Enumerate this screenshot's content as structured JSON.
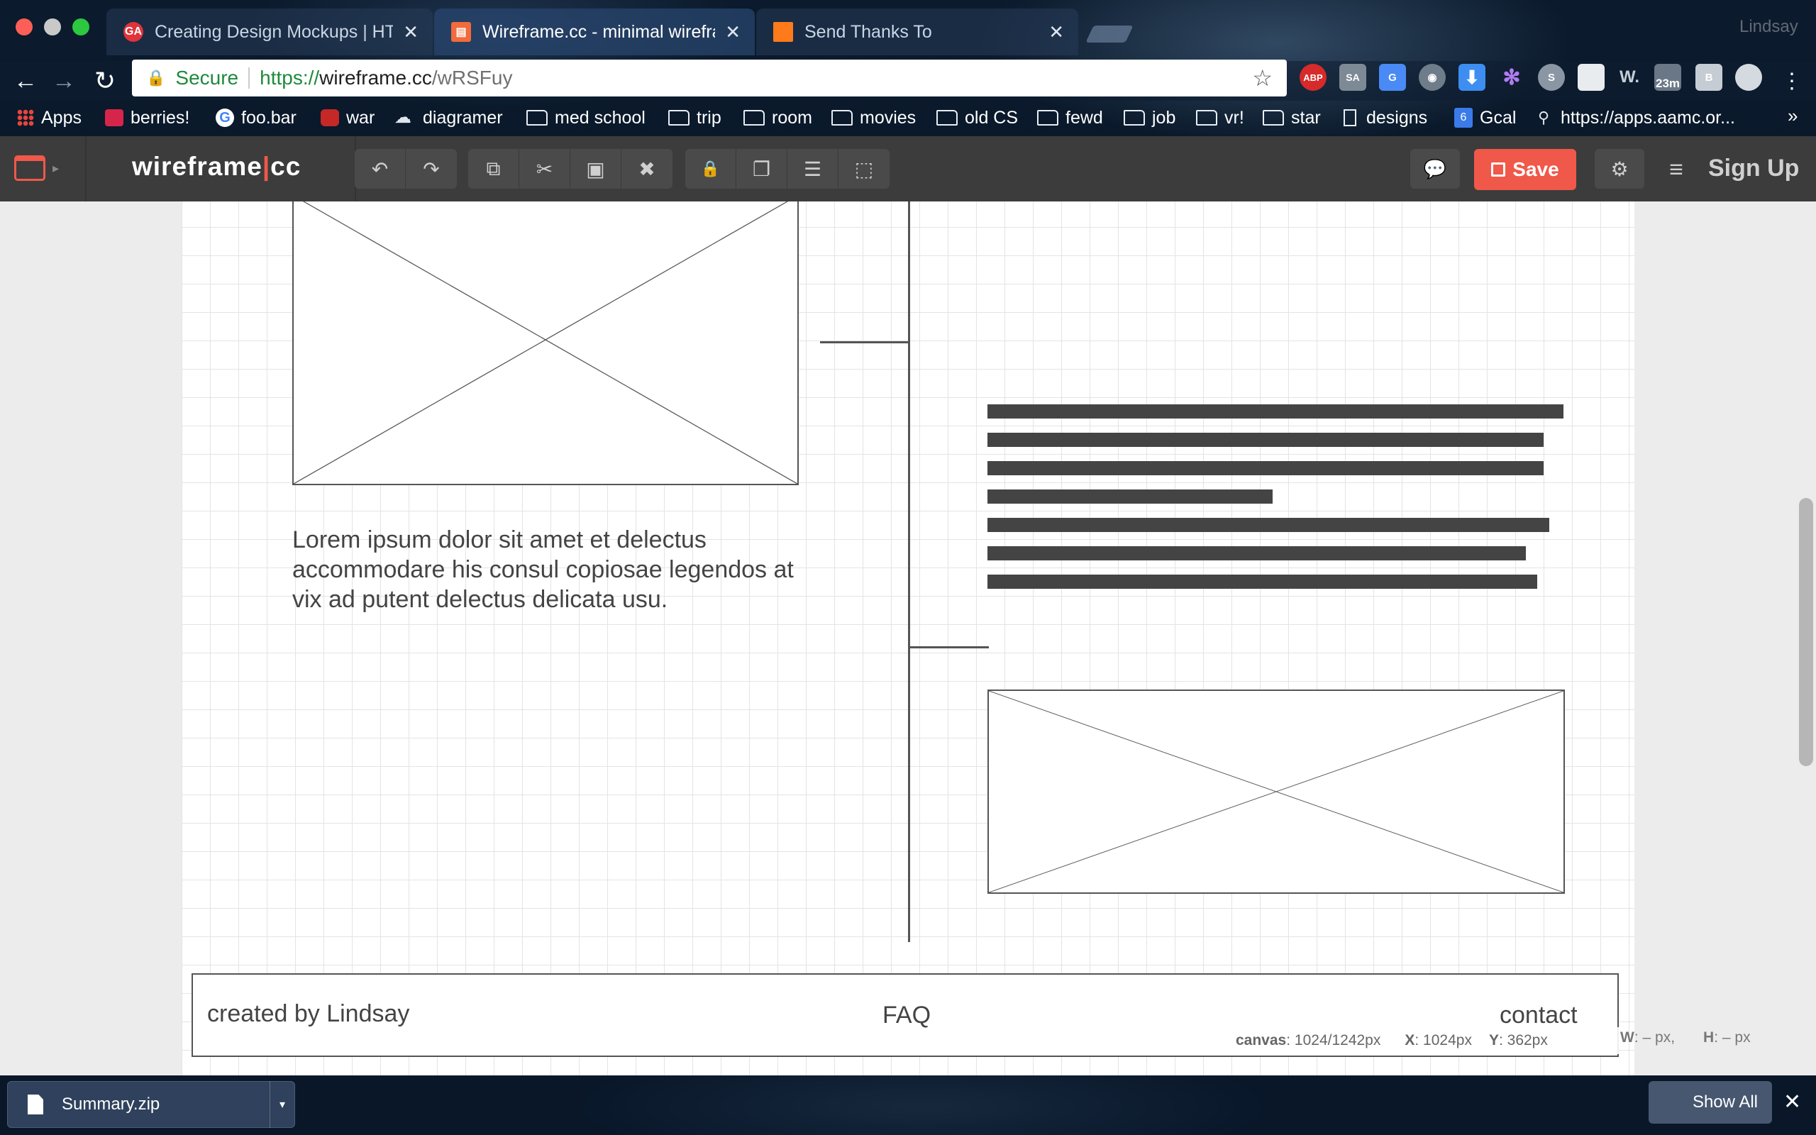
{
  "window": {
    "user_name": "Lindsay"
  },
  "tabs": [
    {
      "title": "Creating Design Mockups | HT",
      "favicon": "ga-icon",
      "active": false
    },
    {
      "title": "Wireframe.cc - minimal wirefra",
      "favicon": "wireframe-icon",
      "active": true
    },
    {
      "title": "Send Thanks To",
      "favicon": "orange-square-icon",
      "active": false
    }
  ],
  "omnibox": {
    "secure_label": "Secure",
    "url_scheme": "https://",
    "url_host": "wireframe.cc",
    "url_path": "/wRSFuy"
  },
  "extensions": {
    "abp": "ABP",
    "sa": "SA",
    "timer": "23m",
    "w": "W.",
    "b": "B"
  },
  "bookmarks": [
    {
      "label": "Apps",
      "icon": "apps-grid-icon"
    },
    {
      "label": "berries!",
      "icon": "berry-icon"
    },
    {
      "label": "foo.bar",
      "icon": "google-icon"
    },
    {
      "label": "war",
      "icon": "hex-icon"
    },
    {
      "label": "diagramer",
      "icon": "cloud-icon"
    },
    {
      "label": "med school",
      "icon": "folder-icon"
    },
    {
      "label": "trip",
      "icon": "folder-icon"
    },
    {
      "label": "room",
      "icon": "folder-icon"
    },
    {
      "label": "movies",
      "icon": "folder-icon"
    },
    {
      "label": "old CS",
      "icon": "folder-icon"
    },
    {
      "label": "fewd",
      "icon": "folder-icon"
    },
    {
      "label": "job",
      "icon": "folder-icon"
    },
    {
      "label": "vr!",
      "icon": "folder-icon"
    },
    {
      "label": "star",
      "icon": "folder-icon"
    },
    {
      "label": "designs",
      "icon": "page-icon"
    },
    {
      "label": "Gcal",
      "icon": "calendar-icon",
      "badge": "6"
    },
    {
      "label": "https://apps.aamc.or...",
      "icon": "link-icon"
    }
  ],
  "app": {
    "logo_left": "wireframe",
    "logo_sep": "|",
    "logo_right": "cc",
    "save_label": "Save",
    "signup_label": "Sign Up",
    "accent": "#f0584a"
  },
  "wireframe": {
    "lorem": "Lorem ipsum dolor sit amet et delectus accommodare his consul copiosae legendos at vix ad putent delectus delicata usu.",
    "text_bar_fractions": [
      1.0,
      0.965,
      0.965,
      0.495,
      0.975,
      0.935,
      0.955
    ],
    "footer": {
      "created_by": "created by Lindsay",
      "faq": "FAQ",
      "contact": "contact"
    }
  },
  "status": {
    "canvas_label": "canvas",
    "canvas_value": ": 1024/1242px",
    "x_label": "X",
    "x_value": ": 1024px",
    "y_label": "Y",
    "y_value": ": 362px",
    "w_label": "W",
    "w_value": ": – px,",
    "h_label": "H",
    "h_value": ": – px"
  },
  "downloads": {
    "file_name": "Summary.zip",
    "show_all_label": "Show All"
  }
}
